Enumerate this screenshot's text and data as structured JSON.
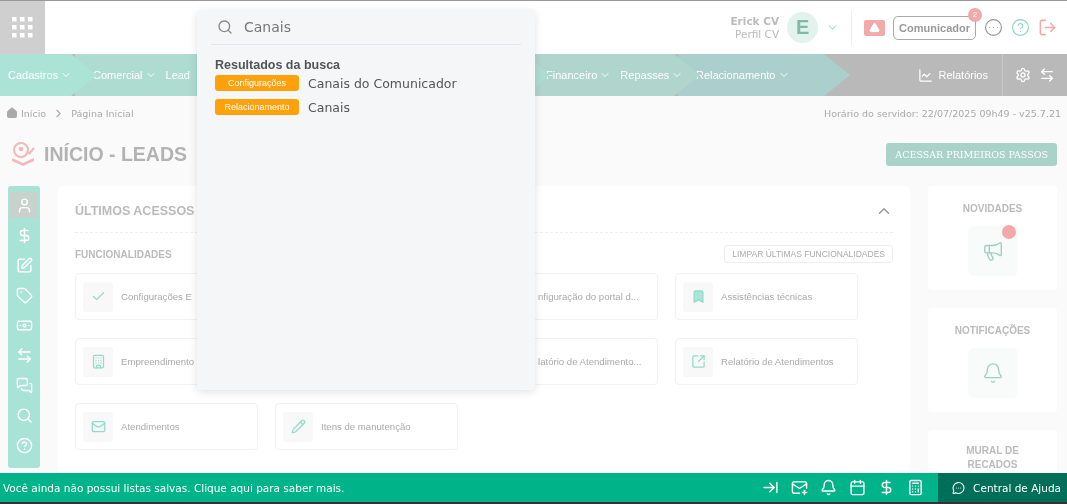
{
  "header": {
    "user_name": "Erick CV",
    "user_profile": "Perfil CV",
    "avatar_letter": "E",
    "communicator": {
      "label": "Comunicador",
      "badge": "2"
    }
  },
  "nav": {
    "segments": [
      {
        "items": [
          {
            "label": "Cadastros",
            "dropdown": true
          }
        ]
      },
      {
        "items": [
          {
            "label": "Comercial",
            "dropdown": true
          },
          {
            "label": "Lead",
            "dropdown": false
          }
        ]
      },
      {
        "items": [
          {
            "label": "Financeiro",
            "dropdown": true
          },
          {
            "label": "Repasses",
            "dropdown": true
          }
        ]
      },
      {
        "items": [
          {
            "label": "Relacionamento",
            "dropdown": true
          }
        ]
      }
    ],
    "reports": "Relatórios"
  },
  "breadcrumb": [
    "Início",
    "Página Inicial"
  ],
  "server_time": "Horário do servidor: 22/07/2025 09h49 - v25.7.21",
  "page_title": "INÍCIO - LEADS",
  "first_steps_button": "ACESSAR PRIMEIROS PASSOS",
  "side_toolbar": [
    {
      "kind": "user",
      "selected": true
    },
    {
      "kind": "dollar",
      "selected": false
    },
    {
      "kind": "edit",
      "selected": false
    },
    {
      "kind": "tag",
      "selected": false
    },
    {
      "kind": "cash",
      "selected": false
    },
    {
      "kind": "swap",
      "selected": false
    },
    {
      "kind": "chat",
      "selected": false
    },
    {
      "kind": "search",
      "selected": false
    },
    {
      "kind": "help",
      "selected": false
    }
  ],
  "recent": {
    "title": "ÚLTIMOS ACESSOS",
    "expanded": true,
    "section": "FUNCIONALIDADES",
    "clear_button": "LIMPAR ÚLTIMAS FUNCIONALIDADES",
    "rows": [
      [
        {
          "kind": "check",
          "label": "Configurações E"
        },
        {
          "kind": "cut",
          "label": "nfiguração do portal d..."
        },
        {
          "kind": "bookmark",
          "label": "Assistências técnicas"
        }
      ],
      [
        {
          "kind": "building",
          "label": "Empreendimento"
        },
        {
          "kind": "cut",
          "label": "latório de Atendimento..."
        },
        {
          "kind": "external",
          "label": "Relatório de Atendimentos"
        }
      ],
      [
        {
          "kind": "mail",
          "label": "Atendimentos"
        },
        {
          "kind": "pencil",
          "label": "Itens de manutenção"
        }
      ]
    ]
  },
  "side_panels": [
    {
      "kind": "news",
      "title": "NOVIDADES",
      "unread": true
    },
    {
      "kind": "notifications",
      "title": "NOTIFICAÇÕES",
      "unread": false
    }
  ],
  "board_title": "MURAL DE RECADOS",
  "footer": {
    "message": "Você ainda não possui listas salvas. Clique aqui para saber mais.",
    "tools": [
      {
        "kind": "collapse"
      },
      {
        "kind": "mail"
      },
      {
        "kind": "bell"
      },
      {
        "kind": "calendar"
      },
      {
        "kind": "dollar"
      },
      {
        "kind": "calculator"
      }
    ],
    "help": "Central de Ajuda"
  },
  "search": {
    "query": "Canais",
    "results_title": "Resultados da busca",
    "results": [
      {
        "tag": "Configurações",
        "label": "Canais do Comunicador"
      },
      {
        "tag": "Relacionamento",
        "label": "Canais"
      }
    ]
  }
}
